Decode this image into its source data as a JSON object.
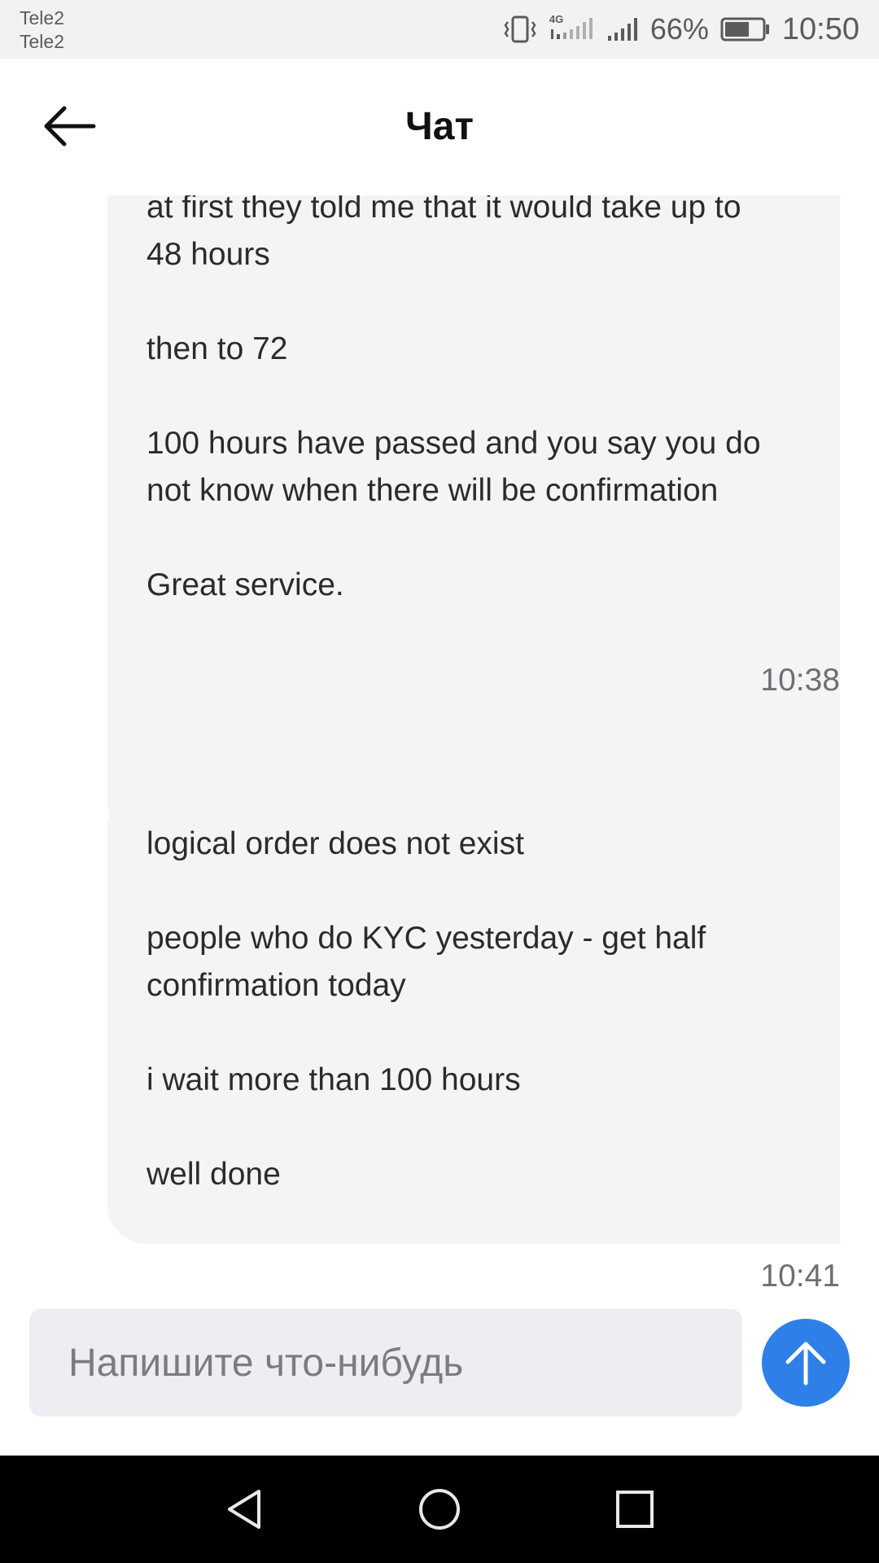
{
  "status_bar": {
    "carrier_1": "Tele2",
    "carrier_2": "Tele2",
    "network_label": "4G",
    "battery_percent": "66%",
    "battery_level": 0.66,
    "time": "10:50"
  },
  "header": {
    "title": "Чат",
    "back_icon": "arrow-left-icon"
  },
  "messages": [
    {
      "lines": [
        "at first they told me that it would take up to",
        "48 hours",
        "",
        "then to 72",
        "",
        "100 hours have passed and you say you do",
        "not know when there will be confirmation",
        "",
        "Great service."
      ],
      "time": "10:38"
    },
    {
      "lines": [
        "logical order does not exist",
        "",
        "people who do KYC yesterday - get half",
        "confirmation today",
        "",
        "i wait more than 100 hours",
        "",
        "well done"
      ],
      "time": "10:41"
    }
  ],
  "composer": {
    "value": "",
    "placeholder": "Напишите что-нибудь",
    "send_icon": "arrow-up-icon",
    "send_color": "#2f7fe8"
  },
  "navbar": {
    "back_icon": "triangle-back-icon",
    "home_icon": "circle-home-icon",
    "recent_icon": "square-recents-icon"
  }
}
